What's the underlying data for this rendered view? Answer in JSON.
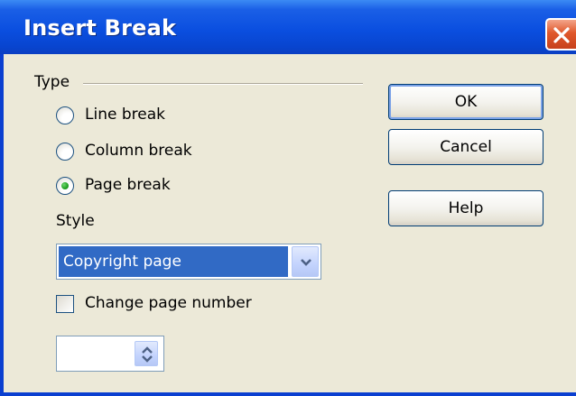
{
  "window": {
    "title": "Insert Break"
  },
  "type_group": {
    "label": "Type",
    "options": [
      {
        "label": "Line break",
        "selected": false
      },
      {
        "label": "Column break",
        "selected": false
      },
      {
        "label": "Page break",
        "selected": true
      }
    ]
  },
  "style": {
    "label": "Style",
    "selected_value": "Copyright page"
  },
  "change_page_number": {
    "label": "Change page number",
    "checked": false
  },
  "page_number": {
    "value": ""
  },
  "buttons": {
    "ok": "OK",
    "cancel": "Cancel",
    "help": "Help"
  },
  "colors": {
    "titlebar": "#0b4fe0",
    "close_button": "#e0582b",
    "dialog_background": "#ece9d8",
    "selection_highlight": "#316ac5",
    "radio_selected_dot": "#21a121"
  },
  "icons": {
    "close": "close-icon",
    "dropdown": "chevron-down-icon",
    "spinner": "spin-arrows-icon"
  }
}
